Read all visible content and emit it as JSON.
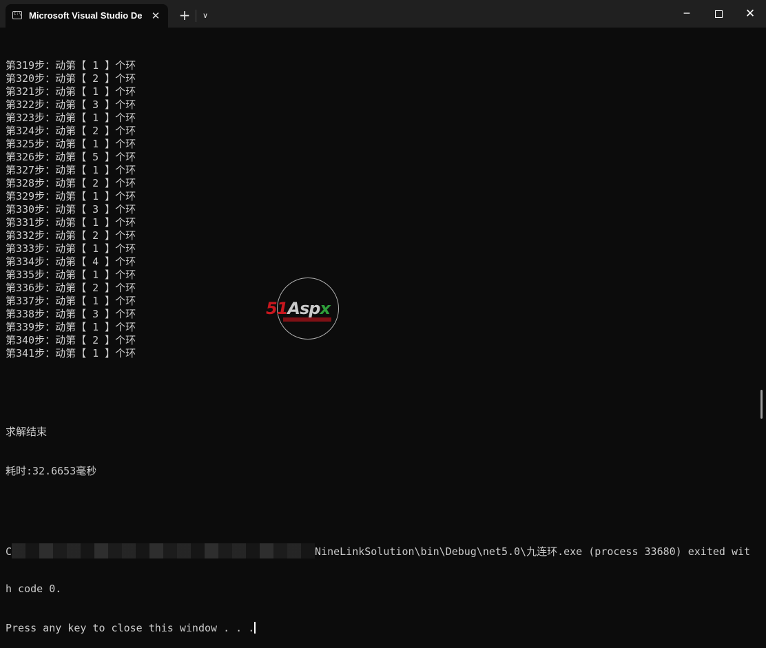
{
  "window": {
    "tab_title": "Microsoft Visual Studio Debug Console",
    "tab_icon": "terminal-icon",
    "new_tab_glyph": "+",
    "dropdown_glyph": "∨",
    "close_tab_glyph": "✕",
    "minimize_glyph": "─",
    "close_glyph": "✕"
  },
  "console": {
    "steps": [
      {
        "label": "第319步：",
        "action": "动第【 1 】个环"
      },
      {
        "label": "第320步：",
        "action": "动第【 2 】个环"
      },
      {
        "label": "第321步：",
        "action": "动第【 1 】个环"
      },
      {
        "label": "第322步：",
        "action": "动第【 3 】个环"
      },
      {
        "label": "第323步：",
        "action": "动第【 1 】个环"
      },
      {
        "label": "第324步：",
        "action": "动第【 2 】个环"
      },
      {
        "label": "第325步：",
        "action": "动第【 1 】个环"
      },
      {
        "label": "第326步：",
        "action": "动第【 5 】个环"
      },
      {
        "label": "第327步：",
        "action": "动第【 1 】个环"
      },
      {
        "label": "第328步：",
        "action": "动第【 2 】个环"
      },
      {
        "label": "第329步：",
        "action": "动第【 1 】个环"
      },
      {
        "label": "第330步：",
        "action": "动第【 3 】个环"
      },
      {
        "label": "第331步：",
        "action": "动第【 1 】个环"
      },
      {
        "label": "第332步：",
        "action": "动第【 2 】个环"
      },
      {
        "label": "第333步：",
        "action": "动第【 1 】个环"
      },
      {
        "label": "第334步：",
        "action": "动第【 4 】个环"
      },
      {
        "label": "第335步：",
        "action": "动第【 1 】个环"
      },
      {
        "label": "第336步：",
        "action": "动第【 2 】个环"
      },
      {
        "label": "第337步：",
        "action": "动第【 1 】个环"
      },
      {
        "label": "第338步：",
        "action": "动第【 3 】个环"
      },
      {
        "label": "第339步：",
        "action": "动第【 1 】个环"
      },
      {
        "label": "第340步：",
        "action": "动第【 2 】个环"
      },
      {
        "label": "第341步：",
        "action": "动第【 1 】个环"
      }
    ],
    "result_title": "求解结束",
    "elapsed": "耗时:32.6653毫秒",
    "exit_prefix": "C",
    "exit_line": "NineLinkSolution\\bin\\Debug\\net5.0\\九连环.exe (process 33680) exited wit",
    "exit_line_2": "h code 0.",
    "close_prompt": "Press any key to close this window . . ."
  },
  "watermark": {
    "logo_51": "51",
    "logo_asp": "Asp",
    "logo_x": "x"
  },
  "colors": {
    "background": "#0c0c0c",
    "titlebar": "#202020",
    "text": "#cccccc"
  }
}
